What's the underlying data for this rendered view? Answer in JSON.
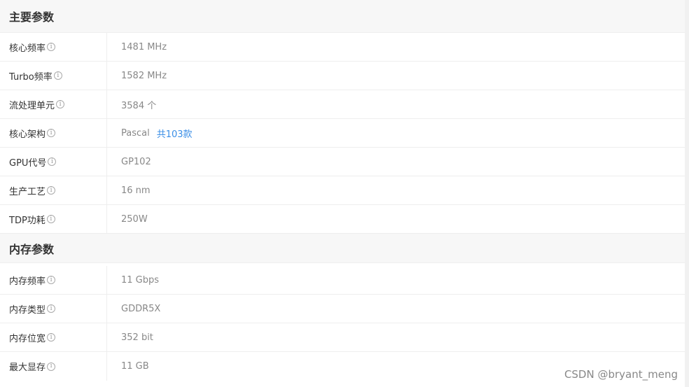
{
  "sections": [
    {
      "title": "主要参数",
      "rows": [
        {
          "label": "核心频率",
          "value": "1481 MHz"
        },
        {
          "label": "Turbo频率",
          "value": "1582 MHz"
        },
        {
          "label": "流处理单元",
          "value": "3584 个"
        },
        {
          "label": "核心架构",
          "value": "Pascal",
          "link": "共103款"
        },
        {
          "label": "GPU代号",
          "value": "GP102"
        },
        {
          "label": "生产工艺",
          "value": "16 nm"
        },
        {
          "label": "TDP功耗",
          "value": "250W"
        }
      ]
    },
    {
      "title": "内存参数",
      "rows": [
        {
          "label": "内存频率",
          "value": "11 Gbps"
        },
        {
          "label": "内存类型",
          "value": "GDDR5X"
        },
        {
          "label": "内存位宽",
          "value": "352 bit"
        },
        {
          "label": "最大显存",
          "value": "11 GB"
        }
      ]
    }
  ],
  "info_icon": {
    "glyph": "i",
    "name": "info-icon"
  },
  "watermark": "CSDN @bryant_meng",
  "colors": {
    "link": "#3a8ee6",
    "label": "#333333",
    "value": "#888888"
  }
}
